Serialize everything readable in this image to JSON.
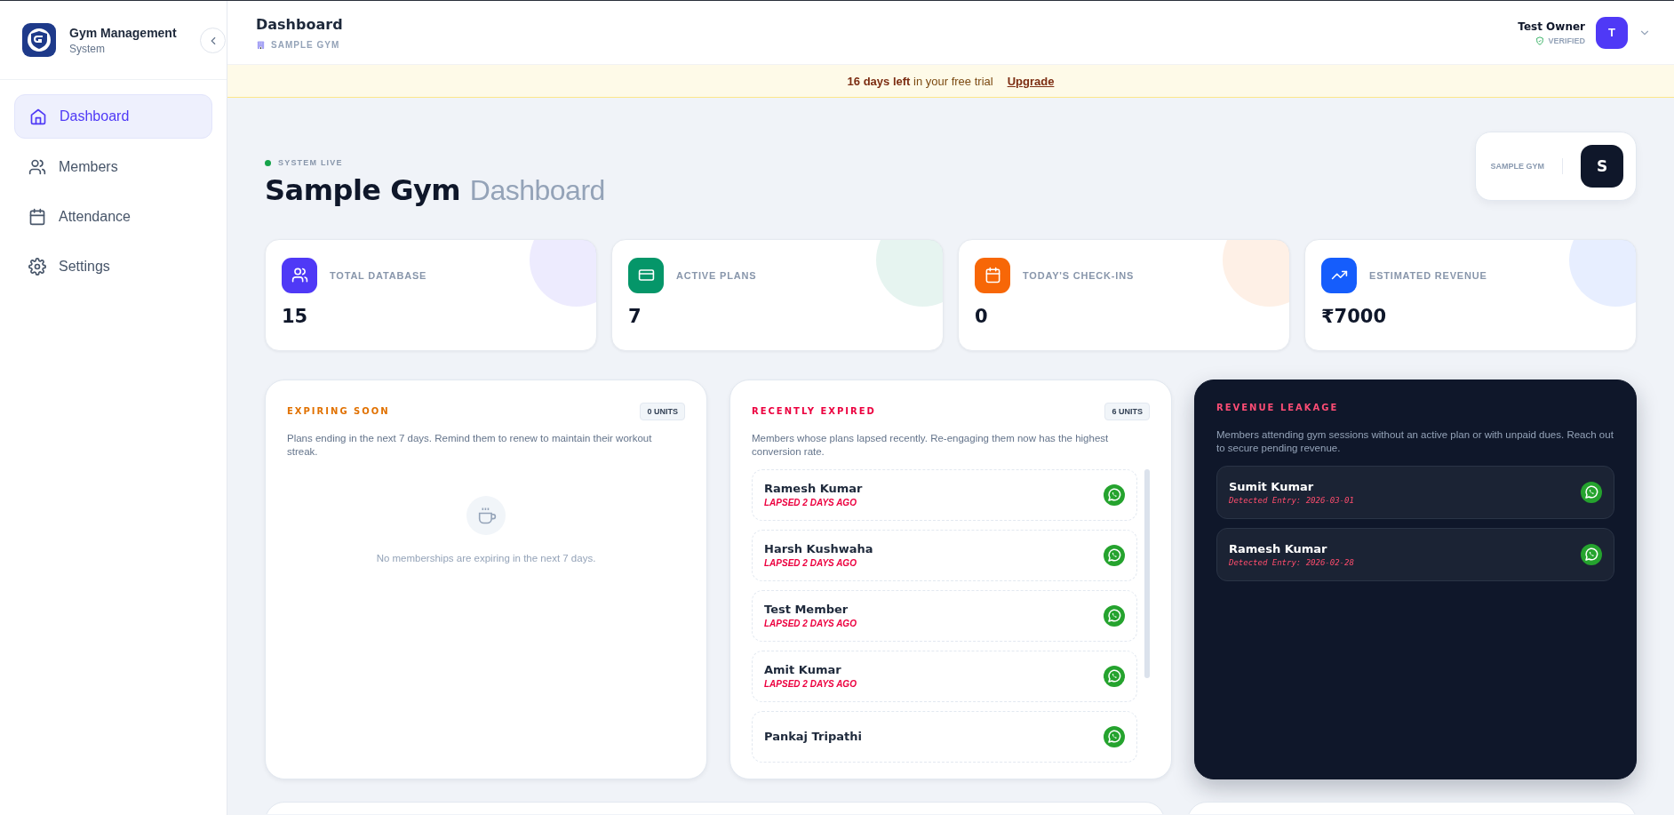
{
  "sidebar": {
    "brand": {
      "title": "Gym Management",
      "subtitle": "System"
    },
    "items": [
      {
        "label": "Dashboard",
        "selected": true
      },
      {
        "label": "Members",
        "selected": false
      },
      {
        "label": "Attendance",
        "selected": false
      },
      {
        "label": "Settings",
        "selected": false
      }
    ]
  },
  "header": {
    "title": "Dashboard",
    "gym": "SAMPLE GYM",
    "user": {
      "name": "Test Owner",
      "status": "VERIFIED",
      "initial": "T"
    }
  },
  "trial_banner": {
    "days": "16 days left",
    "text": "in your free trial",
    "link": "Upgrade"
  },
  "hero": {
    "status": "SYSTEM LIVE",
    "title_bold": "Sample Gym",
    "title_light": "Dashboard",
    "gym_badge": {
      "label": "SAMPLE GYM",
      "initial": "S"
    }
  },
  "stats": [
    {
      "label": "TOTAL DATABASE",
      "value": "15",
      "color": "#4f39f6"
    },
    {
      "label": "ACTIVE PLANS",
      "value": "7",
      "color": "#059669"
    },
    {
      "label": "TODAY'S CHECK-INS",
      "value": "0",
      "color": "#f76707"
    },
    {
      "label": "ESTIMATED REVENUE",
      "value": "₹7000",
      "color": "#155dfc"
    }
  ],
  "panels": [
    {
      "kind": "light",
      "title": "EXPIRING SOON",
      "color": "#e17100",
      "units": "0 UNITS",
      "description": "Plans ending in the next 7 days. Remind them to renew to maintain their workout streak.",
      "empty_message": "No memberships are expiring in the next 7 days."
    },
    {
      "kind": "light",
      "title": "RECENTLY EXPIRED",
      "color": "#ec003f",
      "units": "6 UNITS",
      "description": "Members whose plans lapsed recently. Re-engaging them now has the highest conversion rate.",
      "members": [
        {
          "name": "Ramesh Kumar",
          "note": "LAPSED 2 DAYS AGO"
        },
        {
          "name": "Harsh Kushwaha",
          "note": "LAPSED 2 DAYS AGO"
        },
        {
          "name": "Test Member",
          "note": "LAPSED 2 DAYS AGO"
        },
        {
          "name": "Amit Kumar",
          "note": "LAPSED 2 DAYS AGO"
        },
        {
          "name": "Pankaj Tripathi"
        }
      ]
    },
    {
      "kind": "dark",
      "title": "REVENUE LEAKAGE",
      "color": "#ff4d75",
      "description": "Members attending gym sessions without an active plan or with unpaid dues. Reach out to secure pending revenue.",
      "members": [
        {
          "name": "Sumit Kumar",
          "note": "Detected Entry: 2026-03-01"
        },
        {
          "name": "Ramesh Kumar",
          "note": "Detected Entry: 2026-02-28"
        }
      ]
    }
  ]
}
